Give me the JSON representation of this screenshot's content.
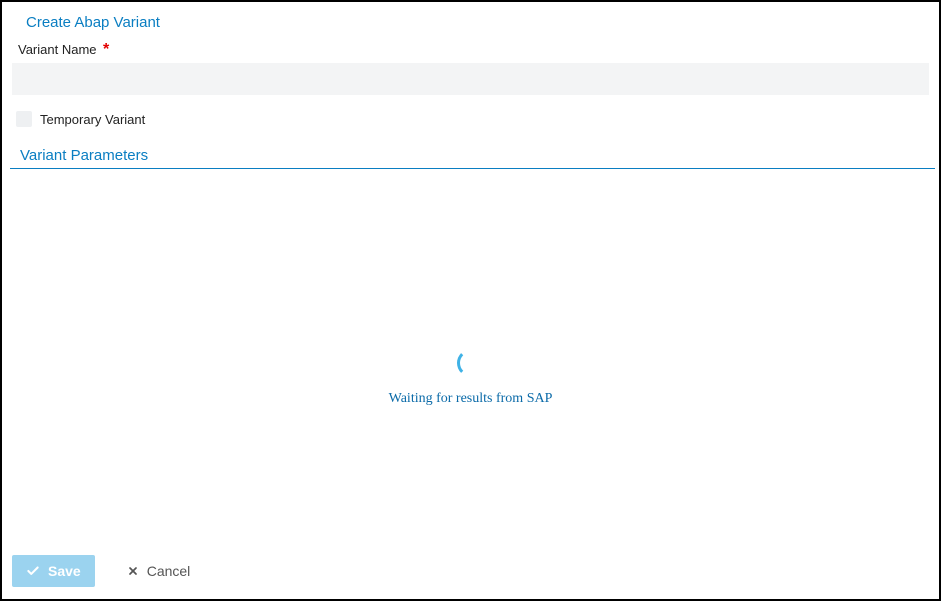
{
  "header": {
    "title": "Create Abap Variant"
  },
  "form": {
    "variantName": {
      "label": "Variant Name",
      "value": "",
      "required": true
    },
    "temporaryVariant": {
      "label": "Temporary Variant",
      "checked": false
    }
  },
  "sections": {
    "parameters": {
      "title": "Variant Parameters"
    }
  },
  "loading": {
    "message": "Waiting for results from SAP"
  },
  "footer": {
    "saveLabel": "Save",
    "cancelLabel": "Cancel"
  },
  "colors": {
    "primary": "#0a7ec2",
    "spinner": "#3fb2e6",
    "saveBg": "#9bd3ef",
    "required": "#e30000"
  }
}
